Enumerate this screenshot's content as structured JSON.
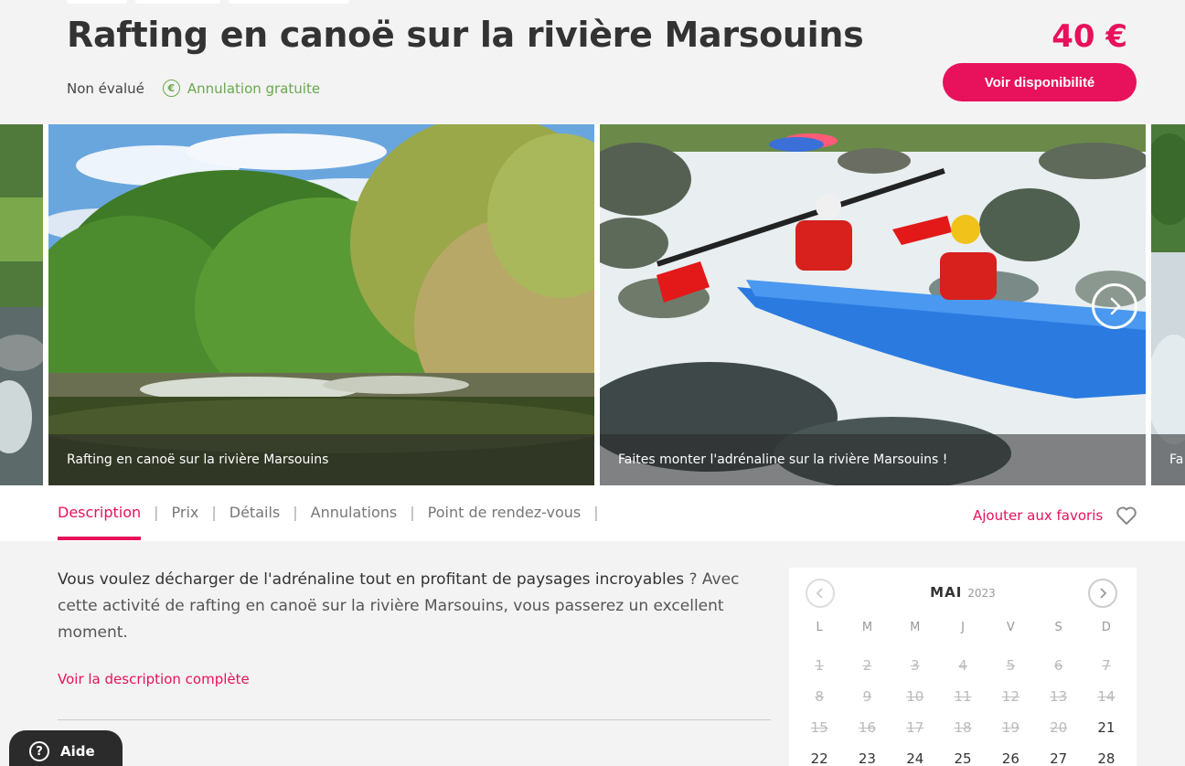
{
  "header": {
    "title": "Rafting en canoë sur la rivière Marsouins",
    "price": "40 €",
    "availability_button": "Voir disponibilité",
    "rating": "Non évalué",
    "cancellation": "Annulation gratuite",
    "cancellation_icon_glyph": "€"
  },
  "gallery": {
    "slides": [
      {
        "caption": "Rafting en canoë sur la rivière Marsouins"
      },
      {
        "caption": "Faites monter l'adrénaline sur la rivière Marsouins !"
      },
      {
        "caption": "Fa"
      }
    ]
  },
  "tabs": [
    {
      "label": "Description",
      "active": true
    },
    {
      "label": "Prix"
    },
    {
      "label": "Détails"
    },
    {
      "label": "Annulations"
    },
    {
      "label": "Point de rendez-vous"
    }
  ],
  "tab_separator": "|",
  "favorites": {
    "label": "Ajouter aux favoris",
    "icon": "heart-icon"
  },
  "description": {
    "lead": "Vous voulez décharger de l'adrénaline tout en profitant de paysages incroyables",
    "rest": " ? Avec cette activité de rafting en canoë sur la rivière Marsouins, vous passerez un excellent moment.",
    "more_link": "Voir la description complète"
  },
  "help": {
    "glyph": "?",
    "label": "Aide"
  },
  "calendar": {
    "month": "MAI",
    "year": "2023",
    "weekdays": [
      "L",
      "M",
      "M",
      "J",
      "V",
      "S",
      "D"
    ],
    "past_days": [
      "1",
      "2",
      "3",
      "4",
      "5",
      "6",
      "7",
      "8",
      "9",
      "10",
      "11",
      "12",
      "13",
      "14",
      "15",
      "16",
      "17",
      "18",
      "19",
      "20"
    ],
    "open_days": [
      "21",
      "22",
      "23",
      "24",
      "25",
      "26",
      "27",
      "28"
    ]
  },
  "colors": {
    "accent": "#e8115b",
    "success": "#6aa84f",
    "text": "#333333"
  }
}
